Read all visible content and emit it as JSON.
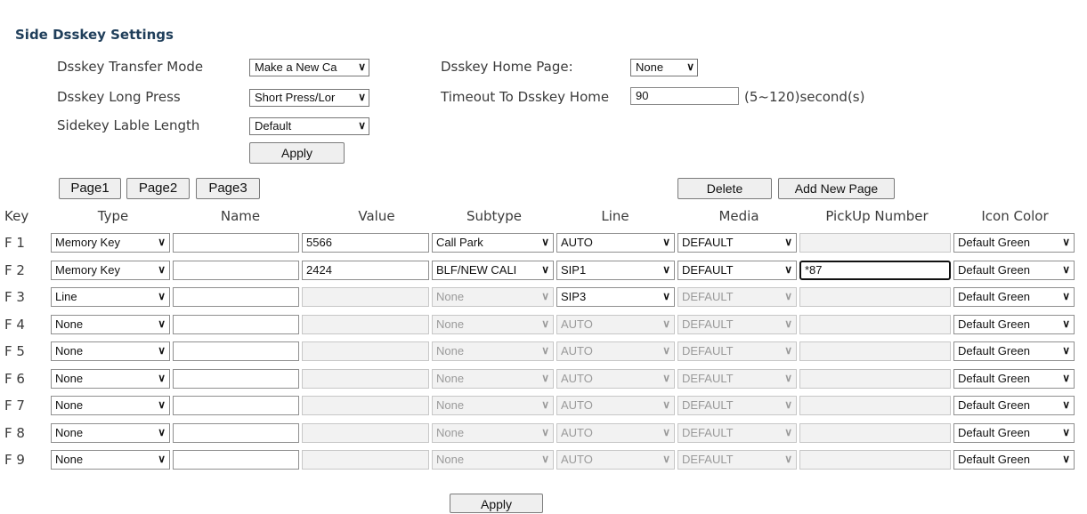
{
  "title": "Side Dsskey Settings",
  "settings": {
    "transfer_mode_label": "Dsskey Transfer Mode",
    "transfer_mode_value": "Make a New Ca",
    "long_press_label": "Dsskey Long Press",
    "long_press_value": "Short Press/Lor",
    "lable_length_label": "Sidekey Lable Length",
    "lable_length_value": "Default",
    "home_page_label": "Dsskey Home Page:",
    "home_page_value": "None",
    "timeout_label": "Timeout To Dsskey Home",
    "timeout_value": "90",
    "timeout_range": "(5~120)second(s)",
    "apply_label": "Apply"
  },
  "pages": {
    "page1": "Page1",
    "page2": "Page2",
    "page3": "Page3",
    "delete_label": "Delete",
    "add_label": "Add New Page"
  },
  "table": {
    "headers": [
      "Key",
      "Type",
      "Name",
      "Value",
      "Subtype",
      "Line",
      "Media",
      "PickUp Number",
      "Icon Color"
    ],
    "rows": [
      {
        "key": "F 1",
        "type": "Memory Key",
        "name": "",
        "value": "5566",
        "subtype": "Call Park",
        "line": "AUTO",
        "media": "DEFAULT",
        "pickup": "",
        "color": "Default Green"
      },
      {
        "key": "F 2",
        "type": "Memory Key",
        "name": "",
        "value": "2424",
        "subtype": "BLF/NEW CALI",
        "line": "SIP1",
        "media": "DEFAULT",
        "pickup": "*87",
        "color": "Default Green"
      },
      {
        "key": "F 3",
        "type": "Line",
        "name": "",
        "value": "",
        "subtype": "None",
        "line": "SIP3",
        "media": "DEFAULT",
        "pickup": "",
        "color": "Default Green"
      },
      {
        "key": "F 4",
        "type": "None",
        "name": "",
        "value": "",
        "subtype": "None",
        "line": "AUTO",
        "media": "DEFAULT",
        "pickup": "",
        "color": "Default Green"
      },
      {
        "key": "F 5",
        "type": "None",
        "name": "",
        "value": "",
        "subtype": "None",
        "line": "AUTO",
        "media": "DEFAULT",
        "pickup": "",
        "color": "Default Green"
      },
      {
        "key": "F 6",
        "type": "None",
        "name": "",
        "value": "",
        "subtype": "None",
        "line": "AUTO",
        "media": "DEFAULT",
        "pickup": "",
        "color": "Default Green"
      },
      {
        "key": "F 7",
        "type": "None",
        "name": "",
        "value": "",
        "subtype": "None",
        "line": "AUTO",
        "media": "DEFAULT",
        "pickup": "",
        "color": "Default Green"
      },
      {
        "key": "F 8",
        "type": "None",
        "name": "",
        "value": "",
        "subtype": "None",
        "line": "AUTO",
        "media": "DEFAULT",
        "pickup": "",
        "color": "Default Green"
      },
      {
        "key": "F 9",
        "type": "None",
        "name": "",
        "value": "",
        "subtype": "None",
        "line": "AUTO",
        "media": "DEFAULT",
        "pickup": "",
        "color": "Default Green"
      }
    ]
  },
  "bottom_apply_label": "Apply"
}
